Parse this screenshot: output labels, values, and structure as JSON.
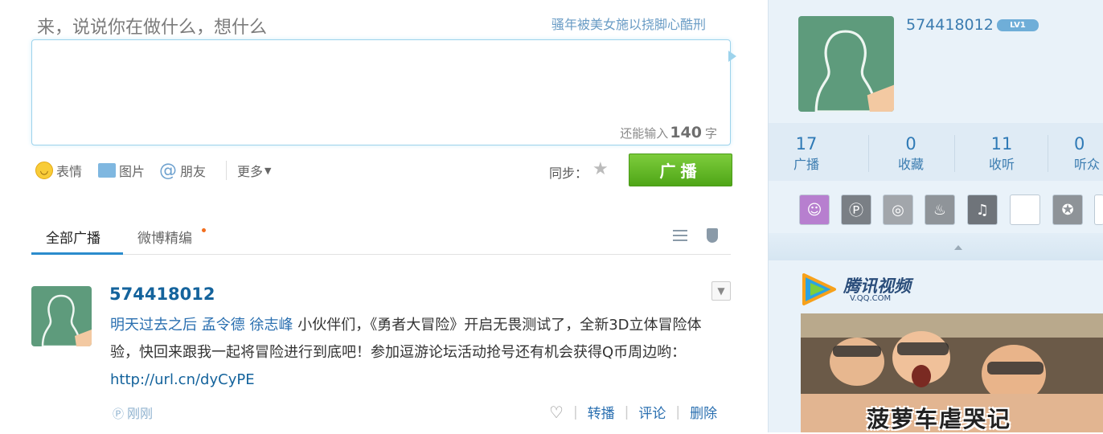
{
  "composer": {
    "prompt": "来，说说你在做什么，想什么",
    "topic_link": "骚年被美女施以挠脚心酷刑",
    "remaining_prefix": "还能输入",
    "remaining_count": "140",
    "remaining_suffix": "字"
  },
  "toolbar": {
    "emoji": "表情",
    "image": "图片",
    "friends": "朋友",
    "more": "更多",
    "sync_label": "同步：",
    "broadcast": "广播"
  },
  "tabs": [
    {
      "label": "全部广播",
      "active": true
    },
    {
      "label": "微博精编",
      "active": false
    }
  ],
  "post": {
    "author": "574418012",
    "mentions": [
      "明天过去之后",
      "孟令德",
      "徐志峰"
    ],
    "text": " 小伙伴们，《勇者大冒险》开启无畏测试了，全新3D立体冒险体验，快回来跟我一起将冒险进行到底吧！参加逗游论坛活动抢号还有机会获得Q币周边哟：",
    "url": "http://url.cn/dyCyPE",
    "time": "刚刚",
    "actions": [
      "转播",
      "评论",
      "删除"
    ]
  },
  "profile": {
    "username": "574418012",
    "level_badge": "LV1",
    "stats": [
      {
        "value": "17",
        "label": "广播"
      },
      {
        "value": "0",
        "label": "收藏"
      },
      {
        "value": "11",
        "label": "收听"
      },
      {
        "value": "0",
        "label": "听众"
      }
    ],
    "apps": [
      "qq-pet-icon",
      "pin-icon",
      "camera-icon",
      "farm-icon",
      "music-icon",
      "blank-icon",
      "star-icon"
    ]
  },
  "ad": {
    "brand": "腾讯视频",
    "domain": "V.QQ.COM",
    "caption": "菠萝车虐哭记"
  },
  "colors": {
    "accent_blue": "#2b8ccd",
    "broadcast_green": "#5cb323",
    "link_blue": "#14639c"
  }
}
